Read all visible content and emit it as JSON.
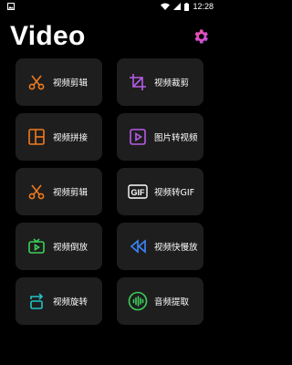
{
  "status_bar": {
    "time": "12:28",
    "icons": [
      "image-notification-icon",
      "wifi-icon",
      "signal-icon",
      "battery-icon"
    ]
  },
  "header": {
    "title": "Video",
    "settings_icon": "gear-icon"
  },
  "colors": {
    "accent_orange": "#f07a1e",
    "accent_purple": "#b65be6",
    "accent_blue": "#3a86ff",
    "accent_green": "#3ccf5a",
    "accent_cyan": "#22c3c6",
    "tile_bg": "#1e1e1e"
  },
  "menu": [
    {
      "label": "视频剪辑",
      "icon": "scissors-icon"
    },
    {
      "label": "视频裁剪",
      "icon": "crop-icon"
    },
    {
      "label": "视频拼接",
      "icon": "split-layout-icon"
    },
    {
      "label": "图片转视频",
      "icon": "play-square-icon"
    },
    {
      "label": "视频剪辑",
      "icon": "scissors-icon"
    },
    {
      "label": "视频转GIF",
      "icon": "gif-icon"
    },
    {
      "label": "视频倒放",
      "icon": "tv-play-icon"
    },
    {
      "label": "视频快慢放",
      "icon": "rewind-icon"
    },
    {
      "label": "视频旋转",
      "icon": "rotate-icon"
    },
    {
      "label": "音频提取",
      "icon": "audio-wave-icon"
    }
  ]
}
